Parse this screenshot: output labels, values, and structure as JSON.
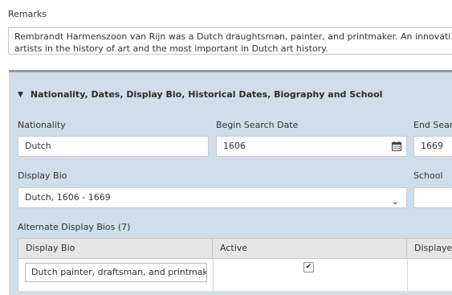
{
  "remarks": {
    "label": "Remarks",
    "line1": "Rembrandt Harmenszoon van Rijn was a Dutch draughtsman, painter, and printmaker. An innovative and",
    "line2": "artists in the history of art and the most important in Dutch art history."
  },
  "section": {
    "title": "Nationality, Dates, Display Bio, Historical Dates, Biography and School",
    "toggle_icon": "triangle-down-icon"
  },
  "fields": {
    "nationality": {
      "label": "Nationality",
      "value": "Dutch"
    },
    "begin_search_date": {
      "label": "Begin Search Date",
      "value": "1606",
      "icon": "calendar-icon"
    },
    "end_search_date": {
      "label": "End Searc",
      "value": "1669"
    },
    "display_bio": {
      "label": "Display Bio",
      "value": "Dutch, 1606 - 1669",
      "icon": "chevron-down-icon"
    },
    "school": {
      "label": "School",
      "value": ""
    }
  },
  "alternate_bios": {
    "label": "Alternate Display Bios (7)",
    "columns": [
      "Display Bio",
      "Active",
      "Displayed"
    ],
    "rows": [
      {
        "display_bio": "Dutch painter, draftsman, and printmaker",
        "active": true
      }
    ]
  }
}
